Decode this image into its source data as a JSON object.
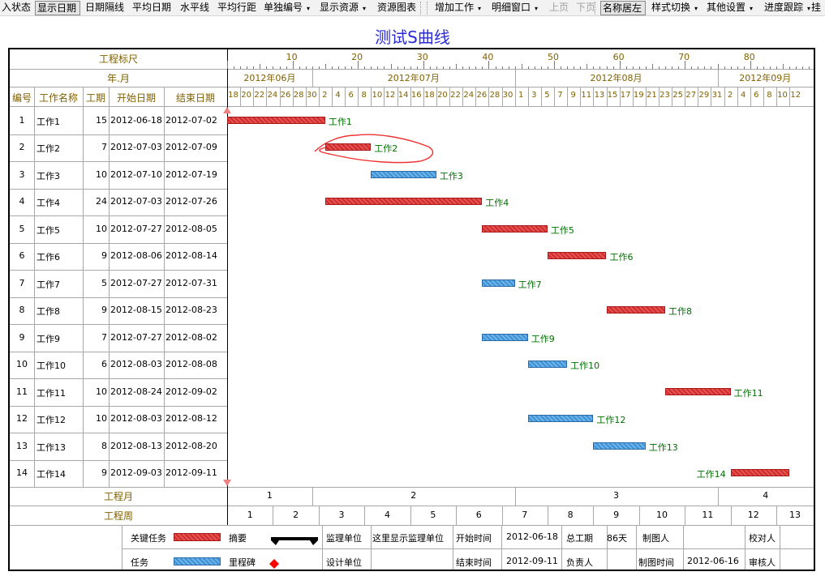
{
  "toolbar": {
    "items": [
      {
        "label": "入状态",
        "pressed": false,
        "dropdown": false,
        "disabled": false
      },
      {
        "label": "显示日期",
        "pressed": true,
        "dropdown": false,
        "disabled": false
      },
      {
        "label": "日期隔线",
        "pressed": false,
        "dropdown": false,
        "disabled": false
      },
      {
        "label": "平均日期",
        "pressed": false,
        "dropdown": false,
        "disabled": false
      },
      {
        "label": "水平线",
        "pressed": false,
        "dropdown": false,
        "disabled": false
      },
      {
        "label": "平均行距",
        "pressed": false,
        "dropdown": false,
        "disabled": false
      },
      {
        "label": "单独编号",
        "pressed": false,
        "dropdown": true,
        "disabled": false
      },
      {
        "label": "显示资源",
        "pressed": false,
        "dropdown": true,
        "disabled": false
      },
      {
        "label": "资源图表",
        "pressed": false,
        "dropdown": false,
        "disabled": false
      },
      {
        "label": "增加工作",
        "pressed": false,
        "dropdown": true,
        "disabled": false
      },
      {
        "label": "明细窗口",
        "pressed": false,
        "dropdown": true,
        "disabled": false
      },
      {
        "label": "上页",
        "pressed": false,
        "dropdown": false,
        "disabled": true
      },
      {
        "label": "下页",
        "pressed": false,
        "dropdown": false,
        "disabled": true
      },
      {
        "label": "名称居左",
        "pressed": true,
        "dropdown": false,
        "disabled": false
      },
      {
        "label": "样式切换",
        "pressed": false,
        "dropdown": true,
        "disabled": false
      },
      {
        "label": "其他设置",
        "pressed": false,
        "dropdown": true,
        "disabled": false
      },
      {
        "label": "进度跟踪",
        "pressed": false,
        "dropdown": true,
        "disabled": false
      },
      {
        "label": "挂",
        "pressed": false,
        "dropdown": false,
        "disabled": false
      }
    ]
  },
  "title": "测试S曲线",
  "header": {
    "ruler_label": "工程标尺",
    "month_label": "年.月",
    "col_id": "编号",
    "col_name": "工作名称",
    "col_duration": "工期",
    "col_start": "开始日期",
    "col_end": "结束日期"
  },
  "ruler_ticks": [
    "10",
    "20",
    "30",
    "40",
    "50",
    "60",
    "70",
    "80"
  ],
  "months": [
    "2012年06月",
    "2012年07月",
    "2012年08月",
    "2012年09月"
  ],
  "days": [
    "18",
    "20",
    "22",
    "24",
    "26",
    "28",
    "30",
    "2",
    "4",
    "6",
    "8",
    "10",
    "12",
    "14",
    "16",
    "18",
    "20",
    "22",
    "24",
    "26",
    "28",
    "30",
    "1",
    "3",
    "5",
    "7",
    "9",
    "11",
    "13",
    "15",
    "17",
    "19",
    "21",
    "23",
    "25",
    "27",
    "29",
    "31",
    "2",
    "4",
    "6",
    "8",
    "10",
    "12"
  ],
  "tasks": [
    {
      "id": "1",
      "name": "工作1",
      "duration": "15",
      "start": "2012-06-18",
      "end": "2012-07-02",
      "critical": true
    },
    {
      "id": "2",
      "name": "工作2",
      "duration": "7",
      "start": "2012-07-03",
      "end": "2012-07-09",
      "critical": true
    },
    {
      "id": "3",
      "name": "工作3",
      "duration": "10",
      "start": "2012-07-10",
      "end": "2012-07-19",
      "critical": false
    },
    {
      "id": "4",
      "name": "工作4",
      "duration": "24",
      "start": "2012-07-03",
      "end": "2012-07-26",
      "critical": true
    },
    {
      "id": "5",
      "name": "工作5",
      "duration": "10",
      "start": "2012-07-27",
      "end": "2012-08-05",
      "critical": true
    },
    {
      "id": "6",
      "name": "工作6",
      "duration": "9",
      "start": "2012-08-06",
      "end": "2012-08-14",
      "critical": true
    },
    {
      "id": "7",
      "name": "工作7",
      "duration": "5",
      "start": "2012-07-27",
      "end": "2012-07-31",
      "critical": false
    },
    {
      "id": "8",
      "name": "工作8",
      "duration": "9",
      "start": "2012-08-15",
      "end": "2012-08-23",
      "critical": true
    },
    {
      "id": "9",
      "name": "工作9",
      "duration": "7",
      "start": "2012-07-27",
      "end": "2012-08-02",
      "critical": false
    },
    {
      "id": "10",
      "name": "工作10",
      "duration": "6",
      "start": "2012-08-03",
      "end": "2012-08-08",
      "critical": false
    },
    {
      "id": "11",
      "name": "工作11",
      "duration": "10",
      "start": "2012-08-24",
      "end": "2012-09-02",
      "critical": true
    },
    {
      "id": "12",
      "name": "工作12",
      "duration": "10",
      "start": "2012-08-03",
      "end": "2012-08-12",
      "critical": false
    },
    {
      "id": "13",
      "name": "工作13",
      "duration": "8",
      "start": "2012-08-13",
      "end": "2012-08-20",
      "critical": false
    },
    {
      "id": "14",
      "name": "工作14",
      "duration": "9",
      "start": "2012-09-03",
      "end": "2012-09-11",
      "critical": true
    }
  ],
  "project_month": {
    "label": "工程月",
    "values": [
      "1",
      "2",
      "3",
      "4"
    ]
  },
  "project_week": {
    "label": "工程周",
    "values": [
      "1",
      "2",
      "3",
      "4",
      "5",
      "6",
      "7",
      "8",
      "9",
      "10",
      "11",
      "12",
      "13"
    ]
  },
  "legend": {
    "critical": "关键任务",
    "summary": "摘要",
    "task": "任务",
    "milestone": "里程碑",
    "colors": {
      "critical": "#d32a2a",
      "task": "#3d92d6",
      "milestone": "#ff0000",
      "annotation": "#ee3333"
    }
  },
  "footer": {
    "supervisor_label": "监理单位",
    "supervisor_value": "这里显示监理单位",
    "design_label": "设计单位",
    "design_value": "",
    "start_label": "开始时间",
    "start_value": "2012-06-18",
    "end_label": "结束时间",
    "end_value": "2012-09-11",
    "total_label": "总工期",
    "total_value": "86天",
    "owner_label": "负责人",
    "owner_value": "",
    "drafter_label": "制图人",
    "drafter_value": "",
    "draw_time_label": "制图时间",
    "draw_time_value": "2012-06-16",
    "checker_label": "校对人",
    "checker_value": "",
    "reviewer_label": "审核人",
    "reviewer_value": ""
  }
}
